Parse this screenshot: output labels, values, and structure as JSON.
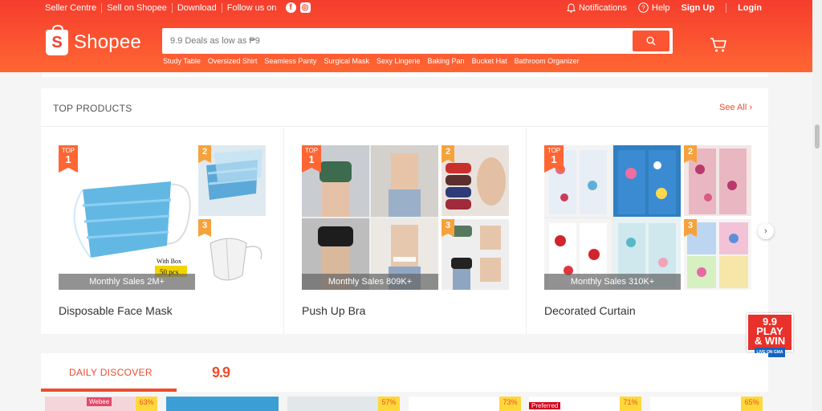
{
  "topbar": {
    "links": [
      "Seller Centre",
      "Sell on Shopee",
      "Download",
      "Follow us on"
    ],
    "notifications": "Notifications",
    "help": "Help",
    "signup": "Sign Up",
    "login": "Login"
  },
  "brand": {
    "name": "Shopee",
    "logo_letter": "S",
    "color": "#ee4d2d"
  },
  "search": {
    "placeholder": "9.9 Deals as low as ₱9",
    "hints": [
      "Study Table",
      "Oversized Shirt",
      "Seamless Panty",
      "Surgical Mask",
      "Sexy Lingerie",
      "Baking Pan",
      "Bucket Hat",
      "Bathroom Organizer"
    ]
  },
  "top_products": {
    "title": "TOP PRODUCTS",
    "see_all": "See All",
    "badge_top": "TOP",
    "cards": [
      {
        "name": "Disposable Face Mask",
        "sales": "Monthly Sales 2M+",
        "caption": "With Box",
        "caption2": "50 pcs"
      },
      {
        "name": "Push Up Bra",
        "sales": "Monthly Sales 809K+"
      },
      {
        "name": "Decorated Curtain",
        "sales": "Monthly Sales 310K+"
      }
    ],
    "rank_labels": [
      "1",
      "2",
      "3"
    ]
  },
  "promo": {
    "line1": "9.9 PLAY",
    "line2": "& WIN",
    "line3": "LIVE ON GMA"
  },
  "daily_discover": {
    "tab": "DAILY DISCOVER",
    "tab2": "9.9",
    "tiles": [
      {
        "tag": "Webee",
        "discount": "63%"
      },
      {
        "tag": "",
        "discount": ""
      },
      {
        "tag": "",
        "discount": "57%"
      },
      {
        "tag": "",
        "discount": "73%"
      },
      {
        "tag": "Preferred",
        "discount": "71%"
      },
      {
        "tag": "",
        "discount": "65%"
      }
    ]
  }
}
